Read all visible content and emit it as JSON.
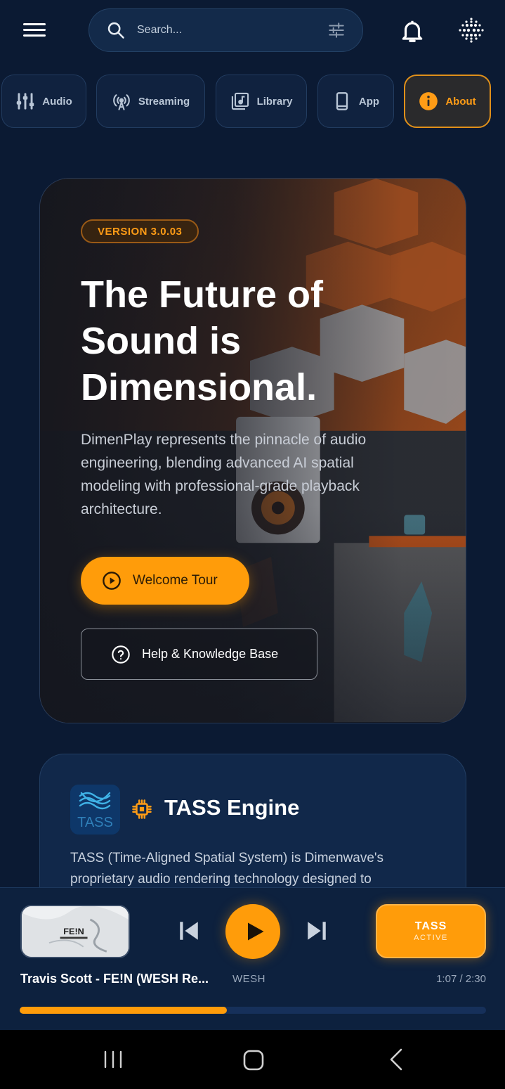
{
  "search": {
    "placeholder": "Search..."
  },
  "tabs": [
    {
      "label": "Audio",
      "icon": "equalizer-icon"
    },
    {
      "label": "Streaming",
      "icon": "broadcast-icon"
    },
    {
      "label": "Library",
      "icon": "music-library-icon"
    },
    {
      "label": "App",
      "icon": "phone-icon"
    },
    {
      "label": "About",
      "icon": "info-icon",
      "active": true
    }
  ],
  "hero": {
    "version": "VERSION 3.0.03",
    "title": "The Future of Sound is Dimensional.",
    "description": "DimenPlay represents the pinnacle of audio engineering, blending advanced AI spatial modeling with professional-grade playback architecture.",
    "tour_label": "Welcome Tour",
    "help_label": "Help & Knowledge Base"
  },
  "tass": {
    "logo_text": "TASS",
    "title": "TASS Engine",
    "description": "TASS (Time-Aligned Spatial System) is Dimenwave's proprietary audio rendering technology designed to"
  },
  "player": {
    "track_title": "Travis Scott - FE!N (WESH Re...",
    "artist": "WESH",
    "time": "1:07 / 2:30",
    "progress": 0.445,
    "tass_label": "TASS",
    "tass_status": "ACTIVE",
    "art_text": "FE!N"
  },
  "colors": {
    "accent": "#ff9c0a",
    "background": "#0b1a33",
    "card": "#11284a"
  }
}
